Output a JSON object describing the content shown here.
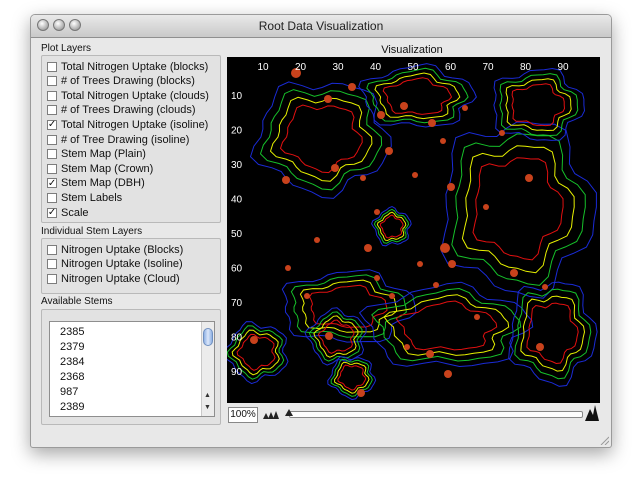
{
  "window": {
    "title": "Root Data Visualization"
  },
  "plot_layers": {
    "label": "Plot Layers",
    "items": [
      {
        "label": "Total Nitrogen Uptake (blocks)",
        "checked": false
      },
      {
        "label": "# of Trees Drawing (blocks)",
        "checked": false
      },
      {
        "label": "Total Nitrogen Uptake (clouds)",
        "checked": false
      },
      {
        "label": "# of Trees Drawing (clouds)",
        "checked": false
      },
      {
        "label": "Total Nitrogen Uptake (isoline)",
        "checked": true
      },
      {
        "label": "# of Tree Drawing (isoline)",
        "checked": false
      },
      {
        "label": "Stem Map (Plain)",
        "checked": false
      },
      {
        "label": "Stem Map (Crown)",
        "checked": false
      },
      {
        "label": "Stem Map (DBH)",
        "checked": true
      },
      {
        "label": "Stem Labels",
        "checked": false
      },
      {
        "label": "Scale",
        "checked": true
      }
    ]
  },
  "stem_layers": {
    "label": "Individual Stem Layers",
    "items": [
      {
        "label": "Nitrogen Uptake (Blocks)",
        "checked": false
      },
      {
        "label": "Nitrogen Uptake (Isoline)",
        "checked": false
      },
      {
        "label": "Nitrogen Uptake (Cloud)",
        "checked": false
      }
    ]
  },
  "available_stems": {
    "label": "Available Stems",
    "items": [
      "2385",
      "2379",
      "2384",
      "2368",
      "987",
      "2389"
    ]
  },
  "visualization": {
    "title": "Visualization",
    "x_ticks": [
      "10",
      "20",
      "30",
      "40",
      "50",
      "60",
      "70",
      "80",
      "90"
    ],
    "y_ticks": [
      "10",
      "20",
      "30",
      "40",
      "50",
      "60",
      "70",
      "80",
      "90"
    ],
    "background": "#000000",
    "isoline_colors": [
      "#1a2bd6",
      "#16c02a",
      "#e6f000",
      "#e01010"
    ],
    "stem_color": "#c8421c"
  },
  "zoom": {
    "value": "100%"
  },
  "icons": {
    "zoom_out": "small-mountains-icon",
    "zoom_in": "large-mountain-icon"
  }
}
